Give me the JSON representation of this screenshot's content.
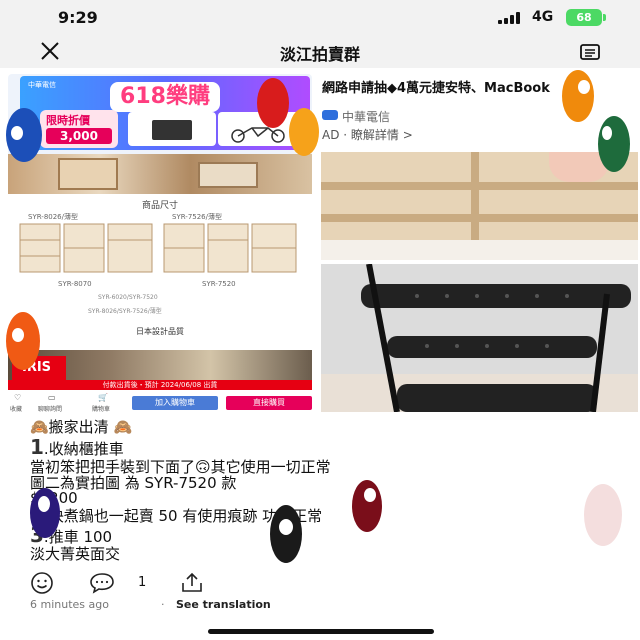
{
  "status_bar": {
    "time": "9:29",
    "network": "4G",
    "battery": "68"
  },
  "header": {
    "title": "淡江拍賣群",
    "close_icon": "close-icon",
    "menu_icon": "menu-icon"
  },
  "ad": {
    "headline": "網路申請抽◆4萬元捷安特、MacBook",
    "sponsor": "中華電信",
    "label": "AD · 瞭解詳情 >",
    "banner": {
      "brand_chip": "中華電信",
      "logo_text": "618樂購節",
      "promo_label": "限時折價",
      "promo_amount": "3,000"
    }
  },
  "product": {
    "spec_title": "商品尺寸",
    "spec_tags": [
      "SYR-8026/薄型",
      "SYR-7526/薄型",
      "SYR-8070",
      "SYR-7520",
      "SYR-6020/SYR-7520",
      "SYR-8026/SYR-7526/薄型"
    ],
    "made_in": "日本設計品質",
    "brand": "IRIS",
    "order_banner": "付款出貨後・預計 2024/06/08 出貨",
    "shop_icons": [
      "收藏",
      "聊聊詢問",
      "購物車"
    ],
    "cart_button": "加入購物車",
    "buy_button": "直接購買"
  },
  "post": {
    "lines": [
      {
        "prefix": "",
        "text": "🙈搬家出清 🙈",
        "big": false
      },
      {
        "prefix": "1",
        "text": ".收納櫃推車",
        "big": true
      },
      {
        "prefix": "",
        "text": "當初笨把把手裝到下面了🙃其它使用一切正常",
        "big": false
      },
      {
        "prefix": "",
        "text": "圖二為實拍圖 為 SYR-7520 款",
        "big": false
      },
      {
        "prefix": "",
        "text": "$1200",
        "big": false
      },
      {
        "prefix": "2",
        "text": ".快煮鍋也一起賣 50 有使用痕跡 功能正常",
        "big": true
      },
      {
        "prefix": "3",
        "text": ".推車 100",
        "big": true
      },
      {
        "prefix": "",
        "text": "淡大菁英面交",
        "big": false
      }
    ],
    "comment_count": "1",
    "timestamp": "6 minutes ago",
    "translate": "See translation"
  },
  "colors": {
    "accent_red": "#e60012",
    "accent_pink": "#e6005a",
    "accent_blue": "#4a7bd6"
  }
}
